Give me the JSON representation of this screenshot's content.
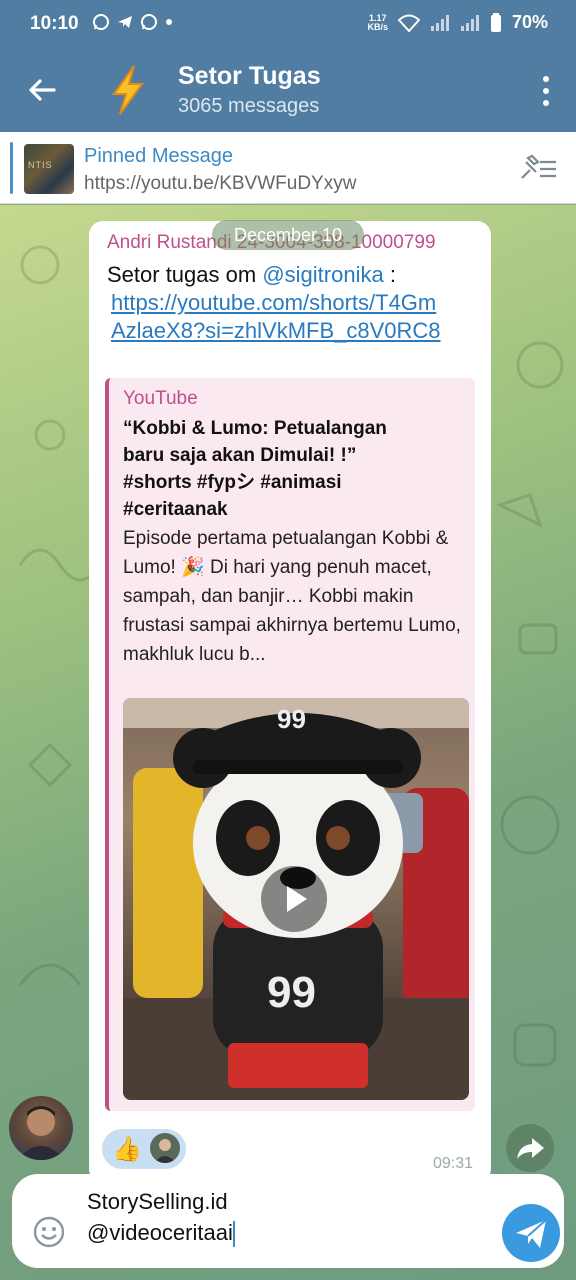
{
  "status_bar": {
    "time": "10:10",
    "net_speed_value": "1.17",
    "net_speed_unit": "KB/s",
    "battery": "70%"
  },
  "header": {
    "title": "Setor Tugas",
    "subtitle": "3065 messages",
    "avatar_icon": "lightning-bolt-icon"
  },
  "pinned": {
    "title": "Pinned Message",
    "text": "https://youtu.be/KBVWFuDYxyw",
    "thumb_text": "NTIS"
  },
  "date_chip": "December 10",
  "message": {
    "sender": "Andri Rustandi 24-3004-308-10000799",
    "text_prefix": "Setor tugas om ",
    "mention": "@sigitronika",
    "text_suffix": " :",
    "link": "https://youtube.com/shorts/T4GmAzlaeX8?si=zhlVkMFB_c8V0RC8",
    "time": "09:31",
    "reaction_emoji": "👍",
    "preview": {
      "site": "YouTube",
      "title": "“Kobbi & Lumo: Petualangan baru saja akan Dimulai! !” #shorts #fypシ #animasi #ceritaanak",
      "description": "Episode pertama petualangan Kobbi & Lumo! 🎉 Di hari yang penuh macet, sampah, dan banjir… Kobbi makin frustasi sampai akhirnya bertemu Lumo, makhluk lucu b...",
      "jersey_number": "99"
    }
  },
  "composer": {
    "text": "StorySelling.id\n@videoceritaai"
  },
  "colors": {
    "header": "#517da2",
    "accent_blue": "#3a9ae0",
    "sender": "#c0508a"
  }
}
